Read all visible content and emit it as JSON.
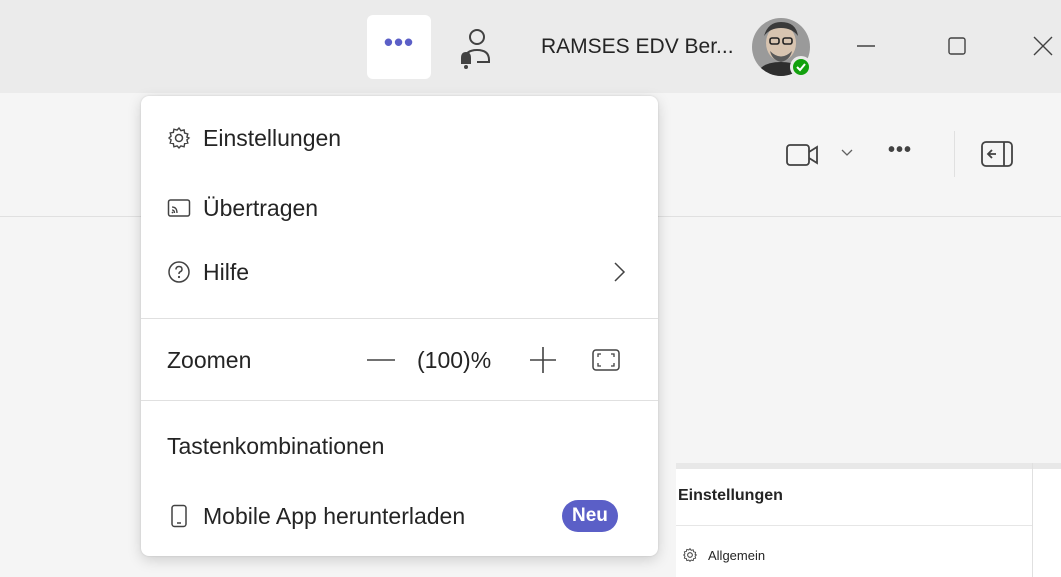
{
  "titlebar": {
    "more_label": "•••",
    "account_name": "RAMSES EDV Ber...",
    "more_icon": "ellipsis-icon",
    "presence_icon": "person-bell-icon",
    "status_color": "#13a10e"
  },
  "toolbar": {
    "more_label": "•••",
    "video_icon": "video-icon",
    "panel_icon": "panel-collapse-icon"
  },
  "menu": {
    "settings_label": "Einstellungen",
    "cast_label": "Übertragen",
    "help_label": "Hilfe",
    "zoom_label": "Zoomen",
    "zoom_value": "(100)%",
    "shortcuts_label": "Tastenkombinationen",
    "mobile_label": "Mobile App herunterladen",
    "new_badge": "Neu"
  },
  "settings_panel": {
    "title": "Einstellungen",
    "item_general": "Allgemein"
  },
  "colors": {
    "accent": "#5b5fc7",
    "titlebar_bg": "#ebebeb",
    "content_bg": "#f5f5f5"
  }
}
